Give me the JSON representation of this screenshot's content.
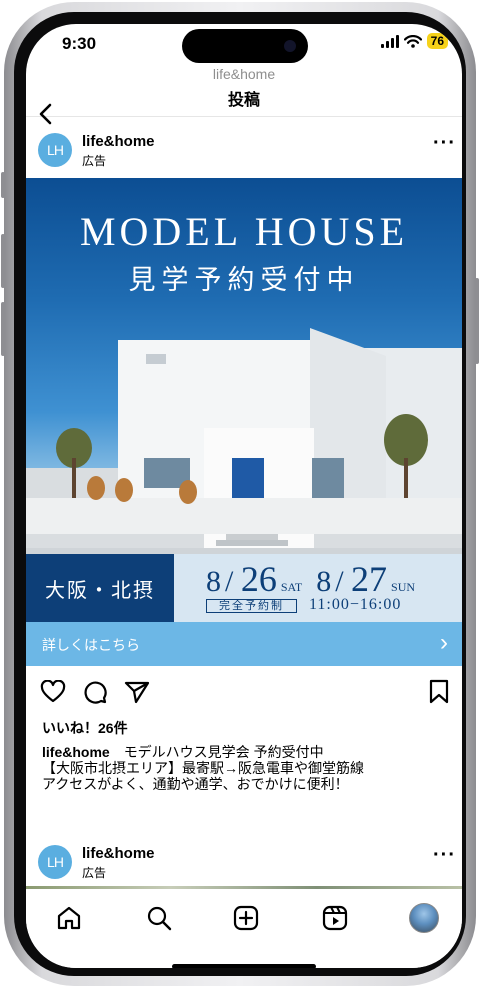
{
  "status": {
    "time": "9:30",
    "battery": "76"
  },
  "nav": {
    "subtitle": "life&home",
    "title": "投稿",
    "back_icon": "chevron-left-icon"
  },
  "post": {
    "avatar_text": "LH",
    "username": "life&home",
    "sponsored": "広告",
    "more_icon": "more-horizontal-icon"
  },
  "ad": {
    "title": "MODEL HOUSE",
    "subtitle": "見学予約受付中",
    "area": "大阪・北摂",
    "date1_month": "8",
    "date1_day": "26",
    "date1_weekday": "SAT",
    "date2_month": "8",
    "date2_day": "27",
    "date2_weekday": "SUN",
    "reservation": "完全予約制",
    "hours": "11:00−16:00",
    "cta_label": "詳しくはこちら",
    "accent": "#0d3f78",
    "cta_color": "#6cb7e6"
  },
  "actions": {
    "icons": [
      "heart-icon",
      "comment-icon",
      "share-icon",
      "bookmark-icon"
    ]
  },
  "likes": "いいね！26件",
  "caption": {
    "username": "life&home",
    "line1": "モデルハウス見学会 予約受付中",
    "line2": "【大阪市北摂エリア】最寄駅→阪急電車や御堂筋線",
    "line3": "アクセスがよく、通勤や通学、おでかけに便利！"
  },
  "next_post": {
    "avatar_text": "LH",
    "username": "life&home",
    "sponsored": "広告"
  },
  "tabbar": {
    "icons": [
      "home-icon",
      "search-icon",
      "create-icon",
      "reels-icon",
      "profile-avatar"
    ]
  }
}
